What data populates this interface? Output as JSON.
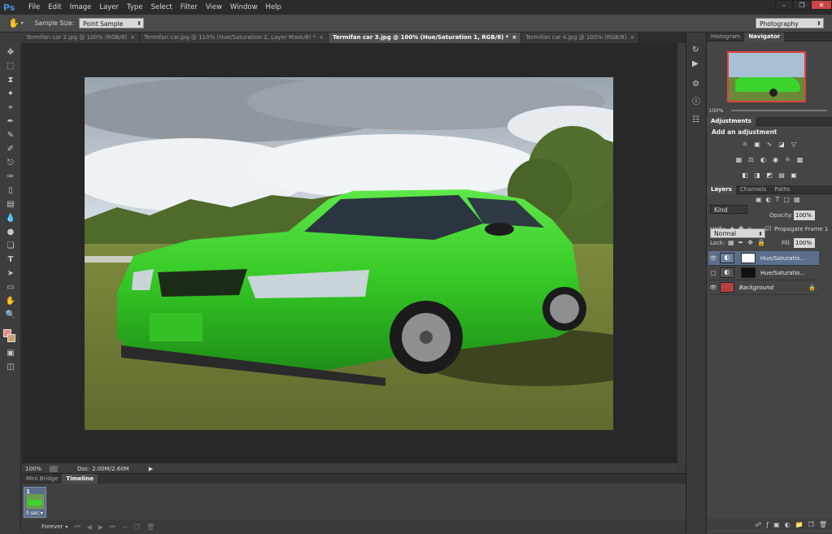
{
  "app": {
    "logo": "Ps"
  },
  "menu": [
    "File",
    "Edit",
    "Image",
    "Layer",
    "Type",
    "Select",
    "Filter",
    "View",
    "Window",
    "Help"
  ],
  "window_controls": {
    "minimize": "–",
    "restore": "❐",
    "close": "✕"
  },
  "options": {
    "sample_size_label": "Sample Size:",
    "sample_size_value": "Point Sample",
    "workspace": "Photography"
  },
  "tabs": [
    {
      "label": "Termifan car 2.jpg @ 100% (RGB/8)",
      "close": "×"
    },
    {
      "label": "Termifan car.jpg @ 110% (Hue/Saturation 2, Layer Mask/8) *",
      "close": "×"
    },
    {
      "label": "Termifan car 3.jpg @ 100% (Hue/Saturation 1, RGB/8) *",
      "close": "×"
    },
    {
      "label": "Termifan car 4.jpg @ 100% (RGB/8)",
      "close": "×"
    }
  ],
  "status": {
    "zoom": "100%",
    "doc": "Doc: 2.00M/2.60M"
  },
  "timeline": {
    "tab_minibridge": "Mini Bridge",
    "tab_timeline": "Timeline",
    "frame_number": "1",
    "frame_delay": "0 sec.▾",
    "loop": "Forever"
  },
  "navigator": {
    "tab_histogram": "Histogram",
    "tab_navigator": "Navigator",
    "zoom": "100%"
  },
  "adjustments": {
    "tab": "Adjustments",
    "title": "Add an adjustment"
  },
  "layers": {
    "tab_layers": "Layers",
    "tab_channels": "Channels",
    "tab_paths": "Paths",
    "filter_kind": "Kind",
    "blend_mode": "Normal",
    "opacity_label": "Opacity:",
    "opacity": "100%",
    "unify_label": "Unify:",
    "propagate": "Propagate Frame 1",
    "lock_label": "Lock:",
    "fill_label": "Fill:",
    "fill": "100%",
    "items": [
      {
        "name": "Hue/Saturatio..."
      },
      {
        "name": "Hue/Saturatio..."
      },
      {
        "name": "Background"
      }
    ]
  },
  "colors": {
    "accent": "#5b6f8c",
    "car": "#3bd42c",
    "fg_swatch": "#e88a8a",
    "bg_swatch": "#c9a070"
  }
}
